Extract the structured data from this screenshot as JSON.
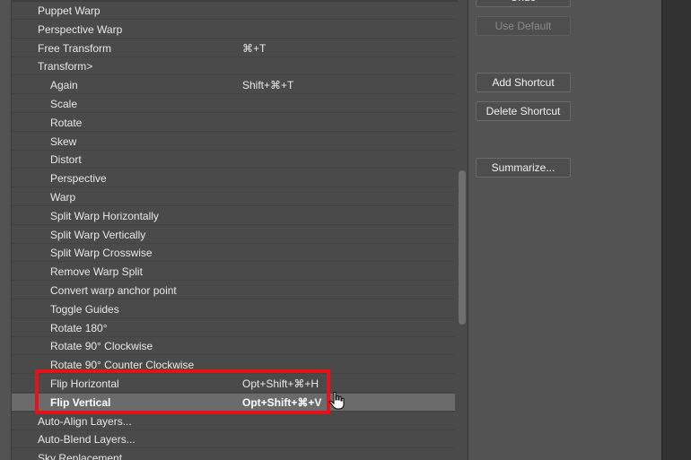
{
  "commands": [
    {
      "label": "Puppet Warp",
      "shortcut": "",
      "level": 0
    },
    {
      "label": "Perspective Warp",
      "shortcut": "",
      "level": 0
    },
    {
      "label": "Free Transform",
      "shortcut": "⌘+T",
      "level": 0
    },
    {
      "label": "Transform>",
      "shortcut": "",
      "level": 0
    },
    {
      "label": "Again",
      "shortcut": "Shift+⌘+T",
      "level": 1
    },
    {
      "label": "Scale",
      "shortcut": "",
      "level": 1
    },
    {
      "label": "Rotate",
      "shortcut": "",
      "level": 1
    },
    {
      "label": "Skew",
      "shortcut": "",
      "level": 1
    },
    {
      "label": "Distort",
      "shortcut": "",
      "level": 1
    },
    {
      "label": "Perspective",
      "shortcut": "",
      "level": 1
    },
    {
      "label": "Warp",
      "shortcut": "",
      "level": 1
    },
    {
      "label": "Split Warp Horizontally",
      "shortcut": "",
      "level": 1
    },
    {
      "label": "Split Warp Vertically",
      "shortcut": "",
      "level": 1
    },
    {
      "label": "Split Warp Crosswise",
      "shortcut": "",
      "level": 1
    },
    {
      "label": "Remove Warp Split",
      "shortcut": "",
      "level": 1
    },
    {
      "label": "Convert warp anchor point",
      "shortcut": "",
      "level": 1
    },
    {
      "label": "Toggle Guides",
      "shortcut": "",
      "level": 1
    },
    {
      "label": "Rotate 180°",
      "shortcut": "",
      "level": 1
    },
    {
      "label": "Rotate 90° Clockwise",
      "shortcut": "",
      "level": 1
    },
    {
      "label": "Rotate 90° Counter Clockwise",
      "shortcut": "",
      "level": 1
    },
    {
      "label": "Flip Horizontal",
      "shortcut": "Opt+Shift+⌘+H",
      "level": 1
    },
    {
      "label": "Flip Vertical",
      "shortcut": "Opt+Shift+⌘+V",
      "level": 1,
      "selected": true
    },
    {
      "label": "Auto-Align Layers...",
      "shortcut": "",
      "level": 0
    },
    {
      "label": "Auto-Blend Layers...",
      "shortcut": "",
      "level": 0
    },
    {
      "label": "Sky Replacement...",
      "shortcut": "",
      "level": 0
    }
  ],
  "buttons": {
    "undo": "Undo",
    "use_default": "Use Default",
    "add_shortcut": "Add Shortcut",
    "delete_shortcut": "Delete Shortcut",
    "summarize": "Summarize..."
  },
  "colors": {
    "highlight": "#e3131b",
    "selected_row": "#6b6b6b"
  }
}
